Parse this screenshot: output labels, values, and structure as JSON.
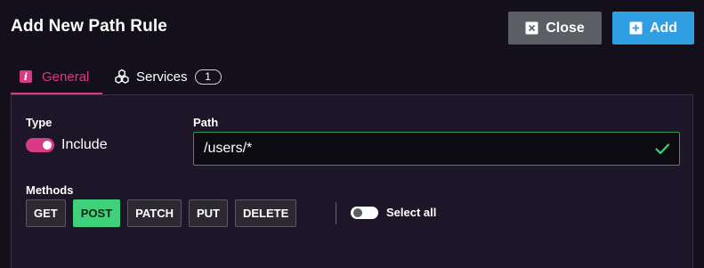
{
  "header": {
    "title": "Add New Path Rule",
    "close_label": "Close",
    "add_label": "Add"
  },
  "tabs": [
    {
      "label": "General",
      "icon": "info-icon",
      "active": true
    },
    {
      "label": "Services",
      "icon": "services-icon",
      "count": "1",
      "active": false
    }
  ],
  "form": {
    "type_label": "Type",
    "type_toggle_label": "Include",
    "type_toggle_on": true,
    "path_label": "Path",
    "path_value": "/users/*",
    "methods_label": "Methods",
    "methods": [
      {
        "label": "GET",
        "selected": false
      },
      {
        "label": "POST",
        "selected": true
      },
      {
        "label": "PATCH",
        "selected": false
      },
      {
        "label": "PUT",
        "selected": false
      },
      {
        "label": "DELETE",
        "selected": false
      }
    ],
    "select_all_label": "Select all",
    "select_all_on": false
  },
  "colors": {
    "accent": "#d93a86",
    "primary": "#2f9ee2",
    "success": "#3fd07a",
    "background": "#13101b"
  }
}
